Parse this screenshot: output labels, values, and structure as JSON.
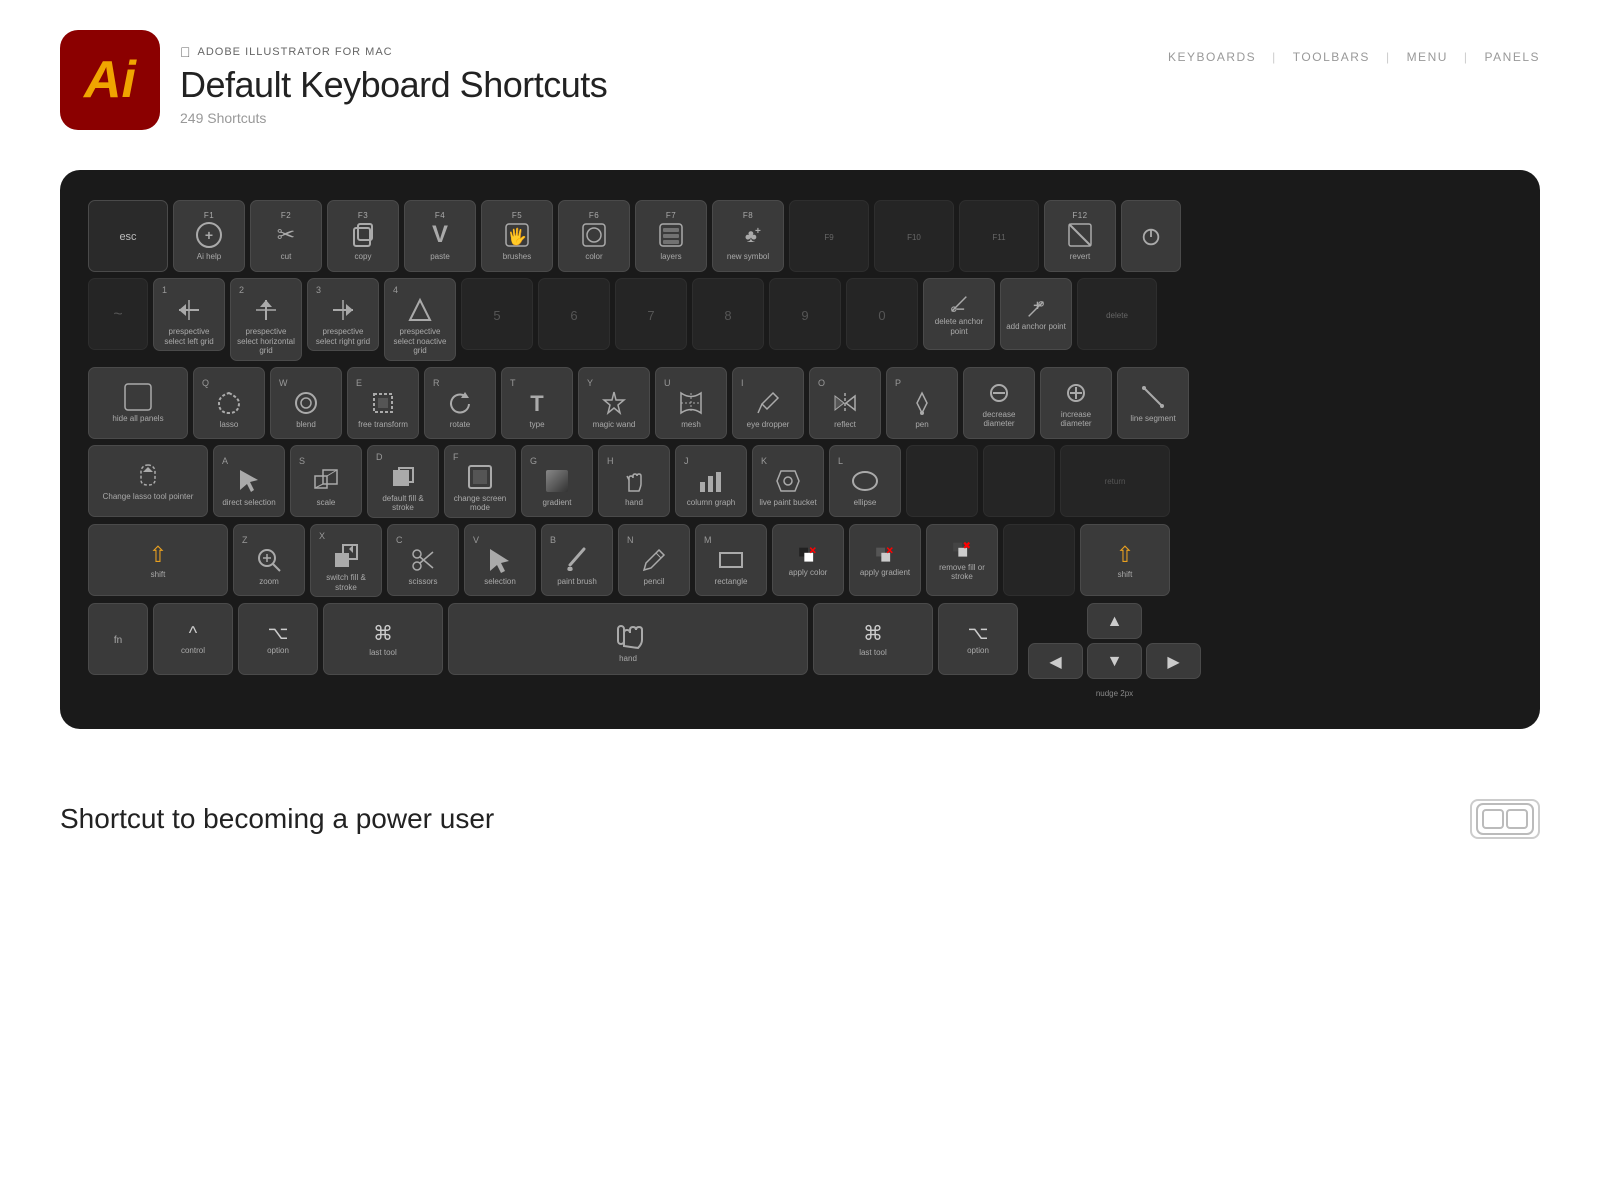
{
  "header": {
    "apple_logo": "",
    "app_name": "ADOBE ILLUSTRATOR FOR MAC",
    "title": "Default Keyboard Shortcuts",
    "subtitle": "249 Shortcuts",
    "nav": {
      "keyboards": "KEYBOARDS",
      "sep1": "|",
      "toolbars": "TOOLBARS",
      "sep2": "|",
      "menu": "MENU",
      "sep3": "|",
      "panels": "PANELS"
    }
  },
  "app_icon": {
    "text": "Ai"
  },
  "tagline": "Shortcut to becoming a power user",
  "brand": "⊏⊐",
  "keyboard": {
    "row1": [
      {
        "id": "esc",
        "label": "esc"
      },
      {
        "id": "f1",
        "fn": "F1",
        "icon": "⊕",
        "label": "Ai help"
      },
      {
        "id": "f2",
        "fn": "F2",
        "icon": "✂",
        "label": "cut"
      },
      {
        "id": "f3",
        "fn": "F3",
        "icon": "C",
        "label": "copy",
        "style": "outline"
      },
      {
        "id": "f4",
        "fn": "F4",
        "icon": "V",
        "label": "paste"
      },
      {
        "id": "f5",
        "fn": "F5",
        "icon": "🖐",
        "label": "brushes"
      },
      {
        "id": "f6",
        "fn": "F6",
        "icon": "⊙",
        "label": "color"
      },
      {
        "id": "f7",
        "fn": "F7",
        "icon": "⧉",
        "label": "layers"
      },
      {
        "id": "f8",
        "fn": "F8",
        "icon": "♣+",
        "label": "new symbol"
      },
      {
        "id": "f9",
        "label": "F9",
        "empty": true
      },
      {
        "id": "f10",
        "label": "F10",
        "empty": true
      },
      {
        "id": "f11",
        "label": "F11",
        "empty": true
      },
      {
        "id": "f12",
        "fn": "F12",
        "icon": "⊘",
        "label": "revert"
      },
      {
        "id": "power",
        "icon": "⏻",
        "label": ""
      }
    ],
    "row2": [
      {
        "id": "tilde",
        "empty": true
      },
      {
        "id": "1",
        "letter": "1",
        "icon": "↔",
        "label": "prespective select left grid"
      },
      {
        "id": "2",
        "letter": "2",
        "icon": "↕",
        "label": "prespective select horizontal grid"
      },
      {
        "id": "3",
        "letter": "3",
        "icon": "↔",
        "label": "prespective select right grid"
      },
      {
        "id": "4",
        "letter": "4",
        "icon": "↗",
        "label": "prespective select noactive grid"
      },
      {
        "id": "5",
        "letter": "5",
        "empty": true
      },
      {
        "id": "6",
        "letter": "6",
        "empty": true
      },
      {
        "id": "7",
        "letter": "7",
        "empty": true
      },
      {
        "id": "8",
        "letter": "8",
        "empty": true
      },
      {
        "id": "9",
        "letter": "9",
        "empty": true
      },
      {
        "id": "0",
        "letter": "0",
        "empty": true
      },
      {
        "id": "minus",
        "icon": "✒",
        "label": "delete anchor point"
      },
      {
        "id": "equals",
        "icon": "✒+",
        "label": "add anchor point"
      },
      {
        "id": "delete",
        "label": "delete"
      }
    ],
    "row3": [
      {
        "id": "tab",
        "icon": "⊞",
        "label": "hide all panels",
        "wide": true
      },
      {
        "id": "q",
        "letter": "Q",
        "icon": "🌀",
        "label": "lasso"
      },
      {
        "id": "w",
        "letter": "W",
        "icon": "⊙",
        "label": "blend"
      },
      {
        "id": "e",
        "letter": "E",
        "icon": "⊡",
        "label": "free transform"
      },
      {
        "id": "r",
        "letter": "R",
        "icon": "↺",
        "label": "rotate"
      },
      {
        "id": "t",
        "letter": "T",
        "icon": "T",
        "label": "type"
      },
      {
        "id": "y",
        "letter": "Y",
        "icon": "✦",
        "label": "magic wand"
      },
      {
        "id": "u",
        "letter": "U",
        "icon": "⊞",
        "label": "mesh"
      },
      {
        "id": "i",
        "letter": "I",
        "icon": "✏",
        "label": "eye dropper"
      },
      {
        "id": "o",
        "letter": "O",
        "icon": "⊳",
        "label": "reflect"
      },
      {
        "id": "p",
        "letter": "P",
        "icon": "✒",
        "label": "pen"
      },
      {
        "id": "bracket_l",
        "icon": "−",
        "label": "decrease diameter"
      },
      {
        "id": "bracket_r",
        "icon": "+",
        "label": "increase diameter"
      },
      {
        "id": "backslash",
        "icon": "/",
        "label": "line segment"
      }
    ],
    "row4": [
      {
        "id": "capslock",
        "icon": "Q",
        "label": "Change lasso tool pointer",
        "wide": true
      },
      {
        "id": "a",
        "letter": "A",
        "icon": "▷",
        "label": "direct selection"
      },
      {
        "id": "s",
        "letter": "S",
        "icon": "⊡",
        "label": "scale"
      },
      {
        "id": "d",
        "letter": "D",
        "icon": "⊟",
        "label": "default fill & stroke"
      },
      {
        "id": "f",
        "letter": "F",
        "icon": "⊡",
        "label": "change screen mode"
      },
      {
        "id": "g",
        "letter": "G",
        "icon": "▦",
        "label": "gradient"
      },
      {
        "id": "h",
        "letter": "H",
        "icon": "✋",
        "label": "hand"
      },
      {
        "id": "j",
        "letter": "J",
        "icon": "▦",
        "label": "column graph"
      },
      {
        "id": "k",
        "letter": "K",
        "icon": "🪣",
        "label": "live paint bucket"
      },
      {
        "id": "l",
        "letter": "L",
        "icon": "○",
        "label": "ellipse"
      },
      {
        "id": "semi",
        "empty": true
      },
      {
        "id": "quote",
        "empty": true
      },
      {
        "id": "enter",
        "label": "return",
        "wide": true,
        "empty": true
      }
    ],
    "row5": [
      {
        "id": "shift_l",
        "icon": "⇧",
        "label": "shift",
        "orange": true,
        "wide": true
      },
      {
        "id": "z",
        "letter": "Z",
        "icon": "🔍",
        "label": "zoom"
      },
      {
        "id": "x",
        "letter": "X",
        "icon": "⊡",
        "label": "switch fill & stroke"
      },
      {
        "id": "c",
        "letter": "C",
        "icon": "✂",
        "label": "scissors"
      },
      {
        "id": "v",
        "letter": "V",
        "icon": "▷",
        "label": "selection"
      },
      {
        "id": "b",
        "letter": "B",
        "icon": "🖌",
        "label": "paint brush"
      },
      {
        "id": "n",
        "letter": "N",
        "icon": "✏",
        "label": "pencil"
      },
      {
        "id": "m",
        "letter": "M",
        "icon": "□",
        "label": "rectangle"
      },
      {
        "id": "comma",
        "icon": "⊟",
        "label": "apply color"
      },
      {
        "id": "period",
        "icon": "⊟",
        "label": "apply gradient"
      },
      {
        "id": "slash",
        "icon": "⊟",
        "label": "remove fill or stroke"
      },
      {
        "id": "shift_r",
        "icon": "⇧",
        "label": "shift",
        "orange": true
      }
    ],
    "row6": [
      {
        "id": "fn",
        "label": "fn"
      },
      {
        "id": "ctrl",
        "icon": "^",
        "label": "control"
      },
      {
        "id": "opt_l",
        "icon": "⌥",
        "label": "option"
      },
      {
        "id": "cmd_l",
        "icon": "⌘",
        "label": "last tool",
        "wide": true
      },
      {
        "id": "space",
        "icon": "✋",
        "label": "hand",
        "extrawide": true
      },
      {
        "id": "cmd_r",
        "icon": "⌘",
        "label": "last tool",
        "wide": true
      },
      {
        "id": "opt_r",
        "icon": "⌥",
        "label": "option"
      },
      {
        "id": "arrows",
        "label": "nudge 2px"
      }
    ]
  }
}
